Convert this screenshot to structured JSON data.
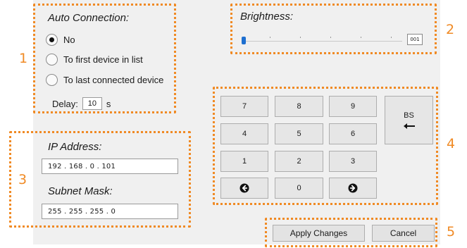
{
  "auto_connection": {
    "title": "Auto Connection:",
    "options": [
      {
        "label": "No",
        "checked": true
      },
      {
        "label": "To first device in list",
        "checked": false
      },
      {
        "label": "To last connected device",
        "checked": false
      }
    ],
    "delay_label": "Delay:",
    "delay_value": "10",
    "delay_unit": "s"
  },
  "network": {
    "ip_title": "IP Address:",
    "ip_value": "192  .  168  .    0   .  101",
    "mask_title": "Subnet Mask:",
    "mask_value": "255  .  255  .  255  .     0"
  },
  "brightness": {
    "title": "Brightness:",
    "value": "001",
    "level": 0.01
  },
  "keypad": {
    "keys": [
      "7",
      "8",
      "9",
      "4",
      "5",
      "6",
      "1",
      "2",
      "3",
      "",
      "0",
      ""
    ],
    "backspace_label": "BS",
    "left_icon": "circle-arrow-left-icon",
    "right_icon": "circle-arrow-right-icon",
    "backspace_icon": "left-arrow-icon"
  },
  "actions": {
    "apply_label": "Apply Changes",
    "cancel_label": "Cancel"
  },
  "callouts": [
    "1",
    "2",
    "3",
    "4",
    "5"
  ],
  "colors": {
    "callout": "#f08a24",
    "panel": "#f0f0f0",
    "slider_thumb": "#1e6fd0"
  }
}
